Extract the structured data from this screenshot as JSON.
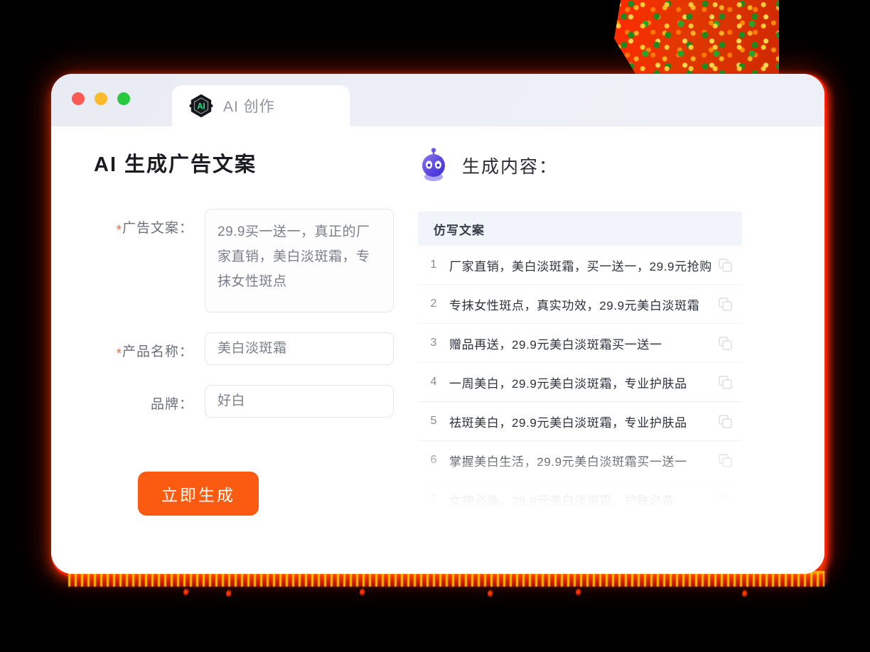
{
  "window": {
    "traffic_lights": [
      {
        "name": "close",
        "color": "#fc5b55"
      },
      {
        "name": "minimize",
        "color": "#fcbb2c"
      },
      {
        "name": "maximize",
        "color": "#2ac840"
      }
    ],
    "tab": {
      "label": "AI 创作",
      "icon": "ai-hexagon-icon",
      "icon_text": "AI"
    }
  },
  "form": {
    "title": "AI 生成广告文案",
    "fields": [
      {
        "label": "广告文案：",
        "required": true,
        "type": "textarea",
        "value": "29.9买一送一，真正的厂家直销，美白淡斑霜，专抹女性斑点"
      },
      {
        "label": "产品名称：",
        "required": true,
        "type": "input",
        "value": "美白淡斑霜"
      },
      {
        "label": "品牌：",
        "required": false,
        "type": "input",
        "value": "好白"
      }
    ],
    "submit_label": "立即生成",
    "accent_color": "#fb5b10"
  },
  "result": {
    "title": "生成内容：",
    "icon": "robot-icon",
    "table": {
      "column_header": "仿写文案",
      "rows": [
        {
          "index": "1",
          "text": "厂家直销，美白淡斑霜，买一送一，29.9元抢购"
        },
        {
          "index": "2",
          "text": "专抹女性斑点，真实功效，29.9元美白淡斑霜"
        },
        {
          "index": "3",
          "text": "赠品再送，29.9元美白淡斑霜买一送一"
        },
        {
          "index": "4",
          "text": "一周美白，29.9元美白淡斑霜，专业护肤品"
        },
        {
          "index": "5",
          "text": "祛斑美白，29.9元美白淡斑霜，专业护肤品"
        },
        {
          "index": "6",
          "text": "掌握美白生活，29.9元美白淡斑霜买一送一"
        },
        {
          "index": "7",
          "text": "女神必备，29.9元美白淡斑霜，护肤必备"
        }
      ],
      "row_action_icon": "copy-icon"
    }
  },
  "decor": {
    "texture_color": "#e63200",
    "glow_color": "#ff1a00"
  }
}
